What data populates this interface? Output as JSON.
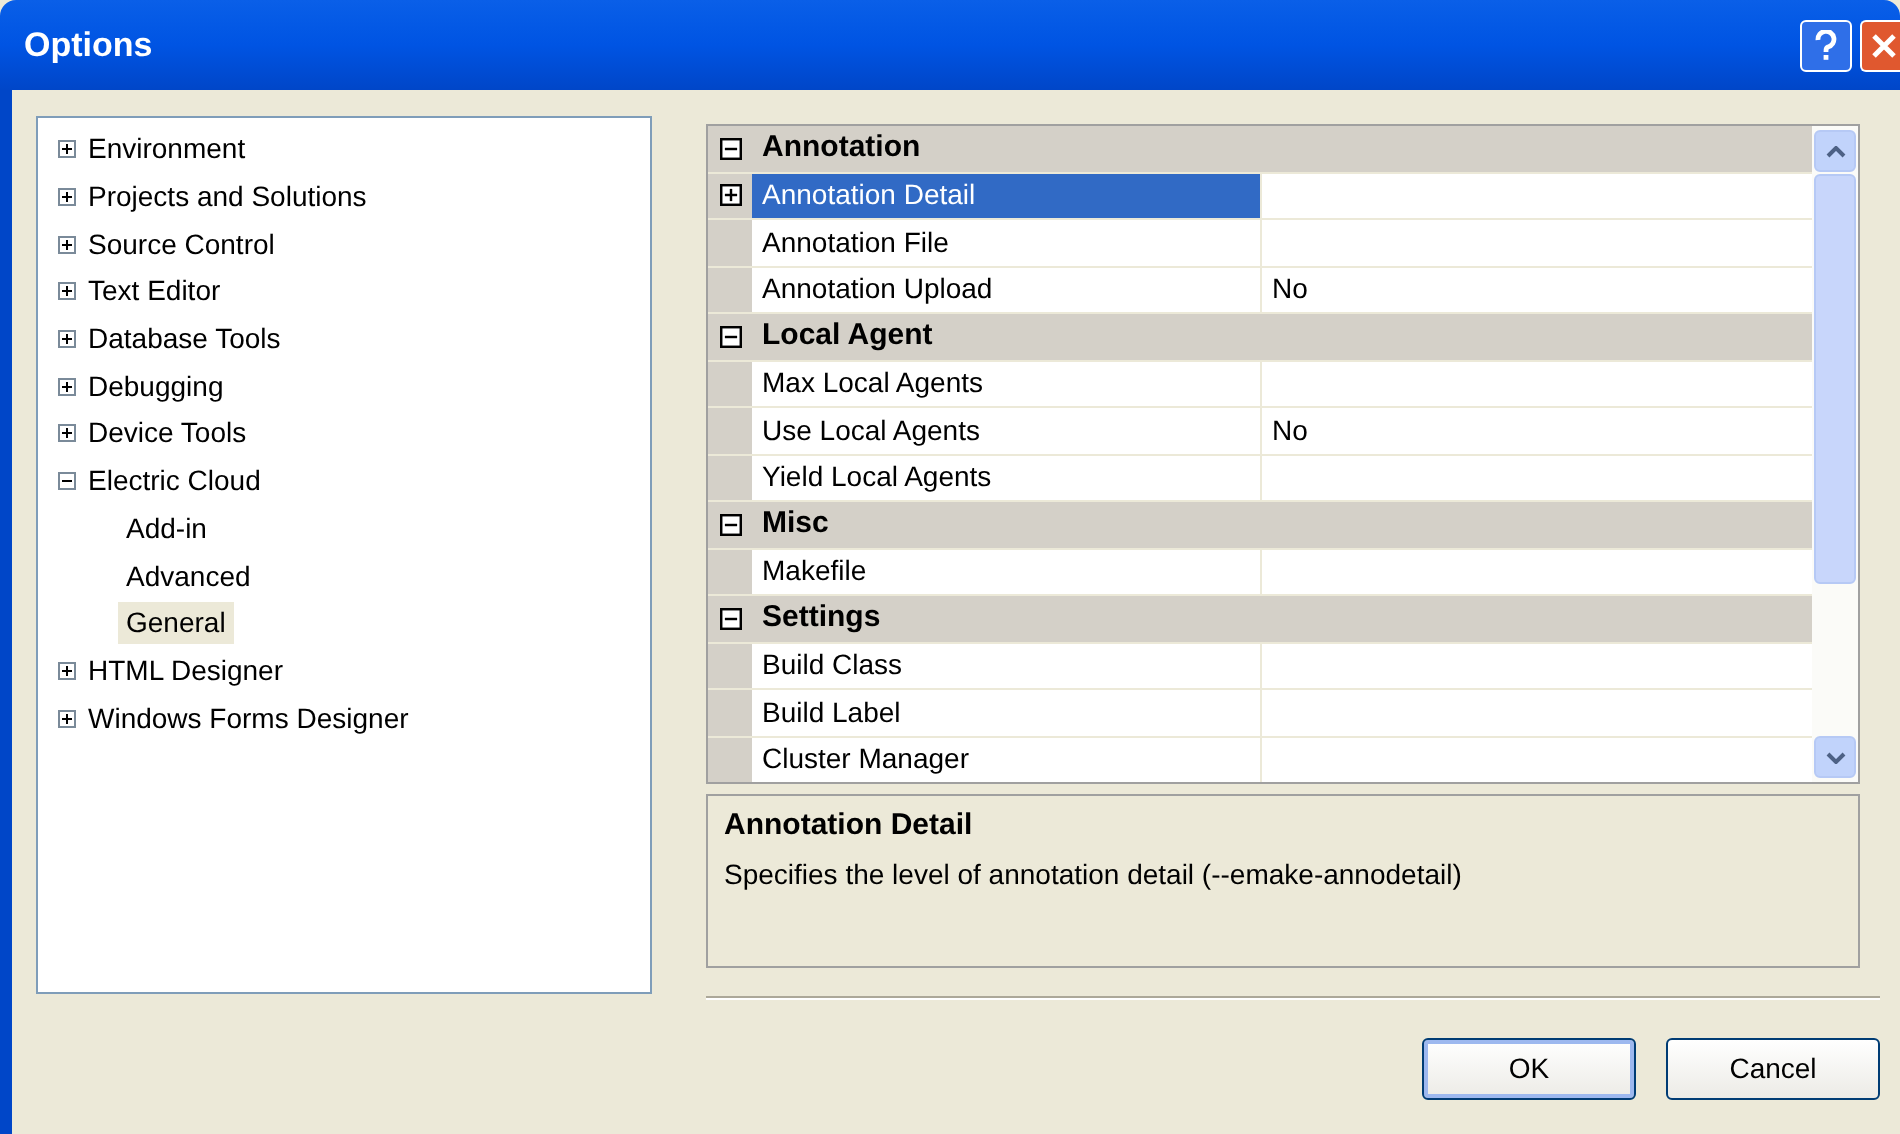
{
  "window": {
    "title": "Options"
  },
  "tree": [
    {
      "label": "Environment",
      "expanded": false,
      "selected": false
    },
    {
      "label": "Projects and Solutions",
      "expanded": false,
      "selected": false
    },
    {
      "label": "Source Control",
      "expanded": false,
      "selected": false
    },
    {
      "label": "Text Editor",
      "expanded": false,
      "selected": false
    },
    {
      "label": "Database Tools",
      "expanded": false,
      "selected": false
    },
    {
      "label": "Debugging",
      "expanded": false,
      "selected": false
    },
    {
      "label": "Device Tools",
      "expanded": false,
      "selected": false
    },
    {
      "label": "Electric Cloud",
      "expanded": true,
      "selected": false,
      "children": [
        {
          "label": "Add-in",
          "selected": false
        },
        {
          "label": "Advanced",
          "selected": false
        },
        {
          "label": "General",
          "selected": true
        }
      ]
    },
    {
      "label": "HTML Designer",
      "expanded": false,
      "selected": false
    },
    {
      "label": "Windows Forms Designer",
      "expanded": false,
      "selected": false
    }
  ],
  "property_grid": [
    {
      "category": "Annotation",
      "expanded": true,
      "properties": [
        {
          "name": "Annotation Detail",
          "selected": true,
          "expandable": true
        },
        {
          "name": "Annotation File",
          "selected": false,
          "expandable": false
        },
        {
          "name": "Annotation Upload",
          "value": "No",
          "selected": false,
          "expandable": false
        }
      ]
    },
    {
      "category": "Local Agent",
      "expanded": true,
      "properties": [
        {
          "name": "Max Local Agents",
          "selected": false,
          "expandable": false
        },
        {
          "name": "Use Local Agents",
          "value": "No",
          "selected": false,
          "expandable": false
        },
        {
          "name": "Yield Local Agents",
          "selected": false,
          "expandable": false
        }
      ]
    },
    {
      "category": "Misc",
      "expanded": true,
      "properties": [
        {
          "name": "Makefile",
          "selected": false,
          "expandable": false
        }
      ]
    },
    {
      "category": "Settings",
      "expanded": true,
      "properties": [
        {
          "name": "Build Class",
          "selected": false,
          "expandable": false
        },
        {
          "name": "Build Label",
          "selected": false,
          "expandable": false
        },
        {
          "name": "Cluster Manager",
          "selected": false,
          "expandable": false
        }
      ]
    }
  ],
  "description": {
    "title": "Annotation Detail",
    "text": "Specifies the level of annotation detail (--emake-annodetail)"
  },
  "buttons": [
    {
      "label": "OK",
      "default": true
    },
    {
      "label": "Cancel",
      "default": false
    }
  ]
}
